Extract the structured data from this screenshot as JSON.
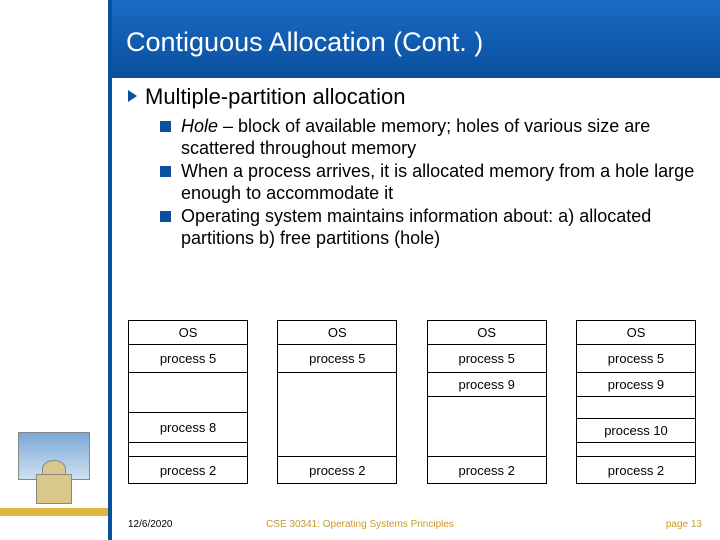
{
  "title": "Contiguous Allocation (Cont. )",
  "bullet1": "Multiple-partition allocation",
  "sub1_italic": "Hole",
  "sub1_rest": " – block of available memory; holes of various size are scattered throughout memory",
  "sub2": "When a process arrives, it is allocated memory from a hole large enough to accommodate it",
  "sub3": "Operating system maintains information about: a) allocated partitions   b) free partitions (hole)",
  "labels": {
    "os": "OS",
    "p5": "process 5",
    "p8": "process 8",
    "p9": "process 9",
    "p10": "process 10",
    "p2": "process 2"
  },
  "footer": {
    "date": "12/6/2020",
    "course": "CSE 30341: Operating Systems Principles",
    "page": "page 13"
  }
}
